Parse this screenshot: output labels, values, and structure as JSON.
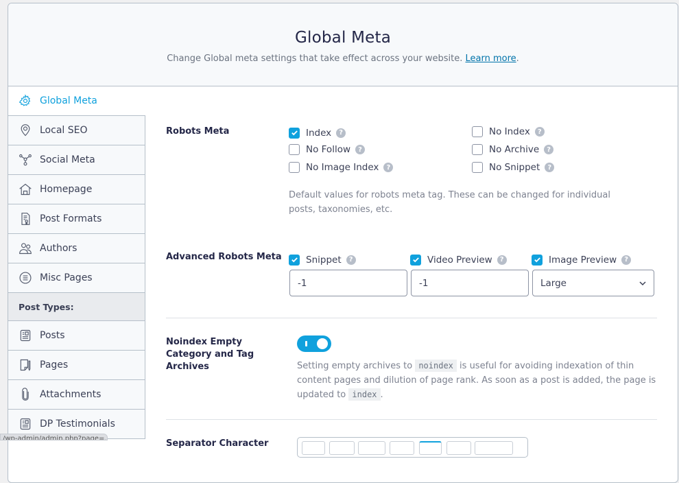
{
  "header": {
    "title": "Global Meta",
    "description": "Change Global meta settings that take effect across your website.",
    "learn_more": "Learn more",
    "period": "."
  },
  "sidebar": {
    "items": [
      {
        "label": "Global Meta",
        "icon": "gear-icon",
        "active": true
      },
      {
        "label": "Local SEO",
        "icon": "location-pin-icon"
      },
      {
        "label": "Social Meta",
        "icon": "share-nodes-icon"
      },
      {
        "label": "Homepage",
        "icon": "home-icon"
      },
      {
        "label": "Post Formats",
        "icon": "post-format-icon"
      },
      {
        "label": "Authors",
        "icon": "users-icon"
      },
      {
        "label": "Misc Pages",
        "icon": "list-circle-icon"
      }
    ],
    "heading": "Post Types:",
    "post_types": [
      {
        "label": "Posts",
        "icon": "post-icon"
      },
      {
        "label": "Pages",
        "icon": "page-icon"
      },
      {
        "label": "Attachments",
        "icon": "paperclip-icon"
      },
      {
        "label": "DP Testimonials",
        "icon": "post-icon"
      }
    ]
  },
  "robots_meta": {
    "label": "Robots Meta",
    "options": [
      {
        "label": "Index",
        "checked": true
      },
      {
        "label": "No Follow",
        "checked": false
      },
      {
        "label": "No Image Index",
        "checked": false
      },
      {
        "label": "No Index",
        "checked": false
      },
      {
        "label": "No Archive",
        "checked": false
      },
      {
        "label": "No Snippet",
        "checked": false
      }
    ],
    "description": "Default values for robots meta tag. These can be changed for individual posts, taxonomies, etc."
  },
  "advanced_robots": {
    "label": "Advanced Robots Meta",
    "snippet": {
      "label": "Snippet",
      "checked": true,
      "value": "-1"
    },
    "video_preview": {
      "label": "Video Preview",
      "checked": true,
      "value": "-1"
    },
    "image_preview": {
      "label": "Image Preview",
      "checked": true,
      "value": "Large"
    }
  },
  "noindex_empty": {
    "label": "Noindex Empty Category and Tag Archives",
    "enabled": true,
    "desc_part1": "Setting empty archives to",
    "code1": "noindex",
    "desc_part2": "is useful for avoiding indexation of thin content pages and dilution of page rank. As soon as a post is added, the page is updated to",
    "code2": "index",
    "desc_end": "."
  },
  "separator": {
    "label": "Separator Character"
  },
  "help_glyph": "?",
  "status_tooltip": "/wp-admin/admin.php?page=..."
}
